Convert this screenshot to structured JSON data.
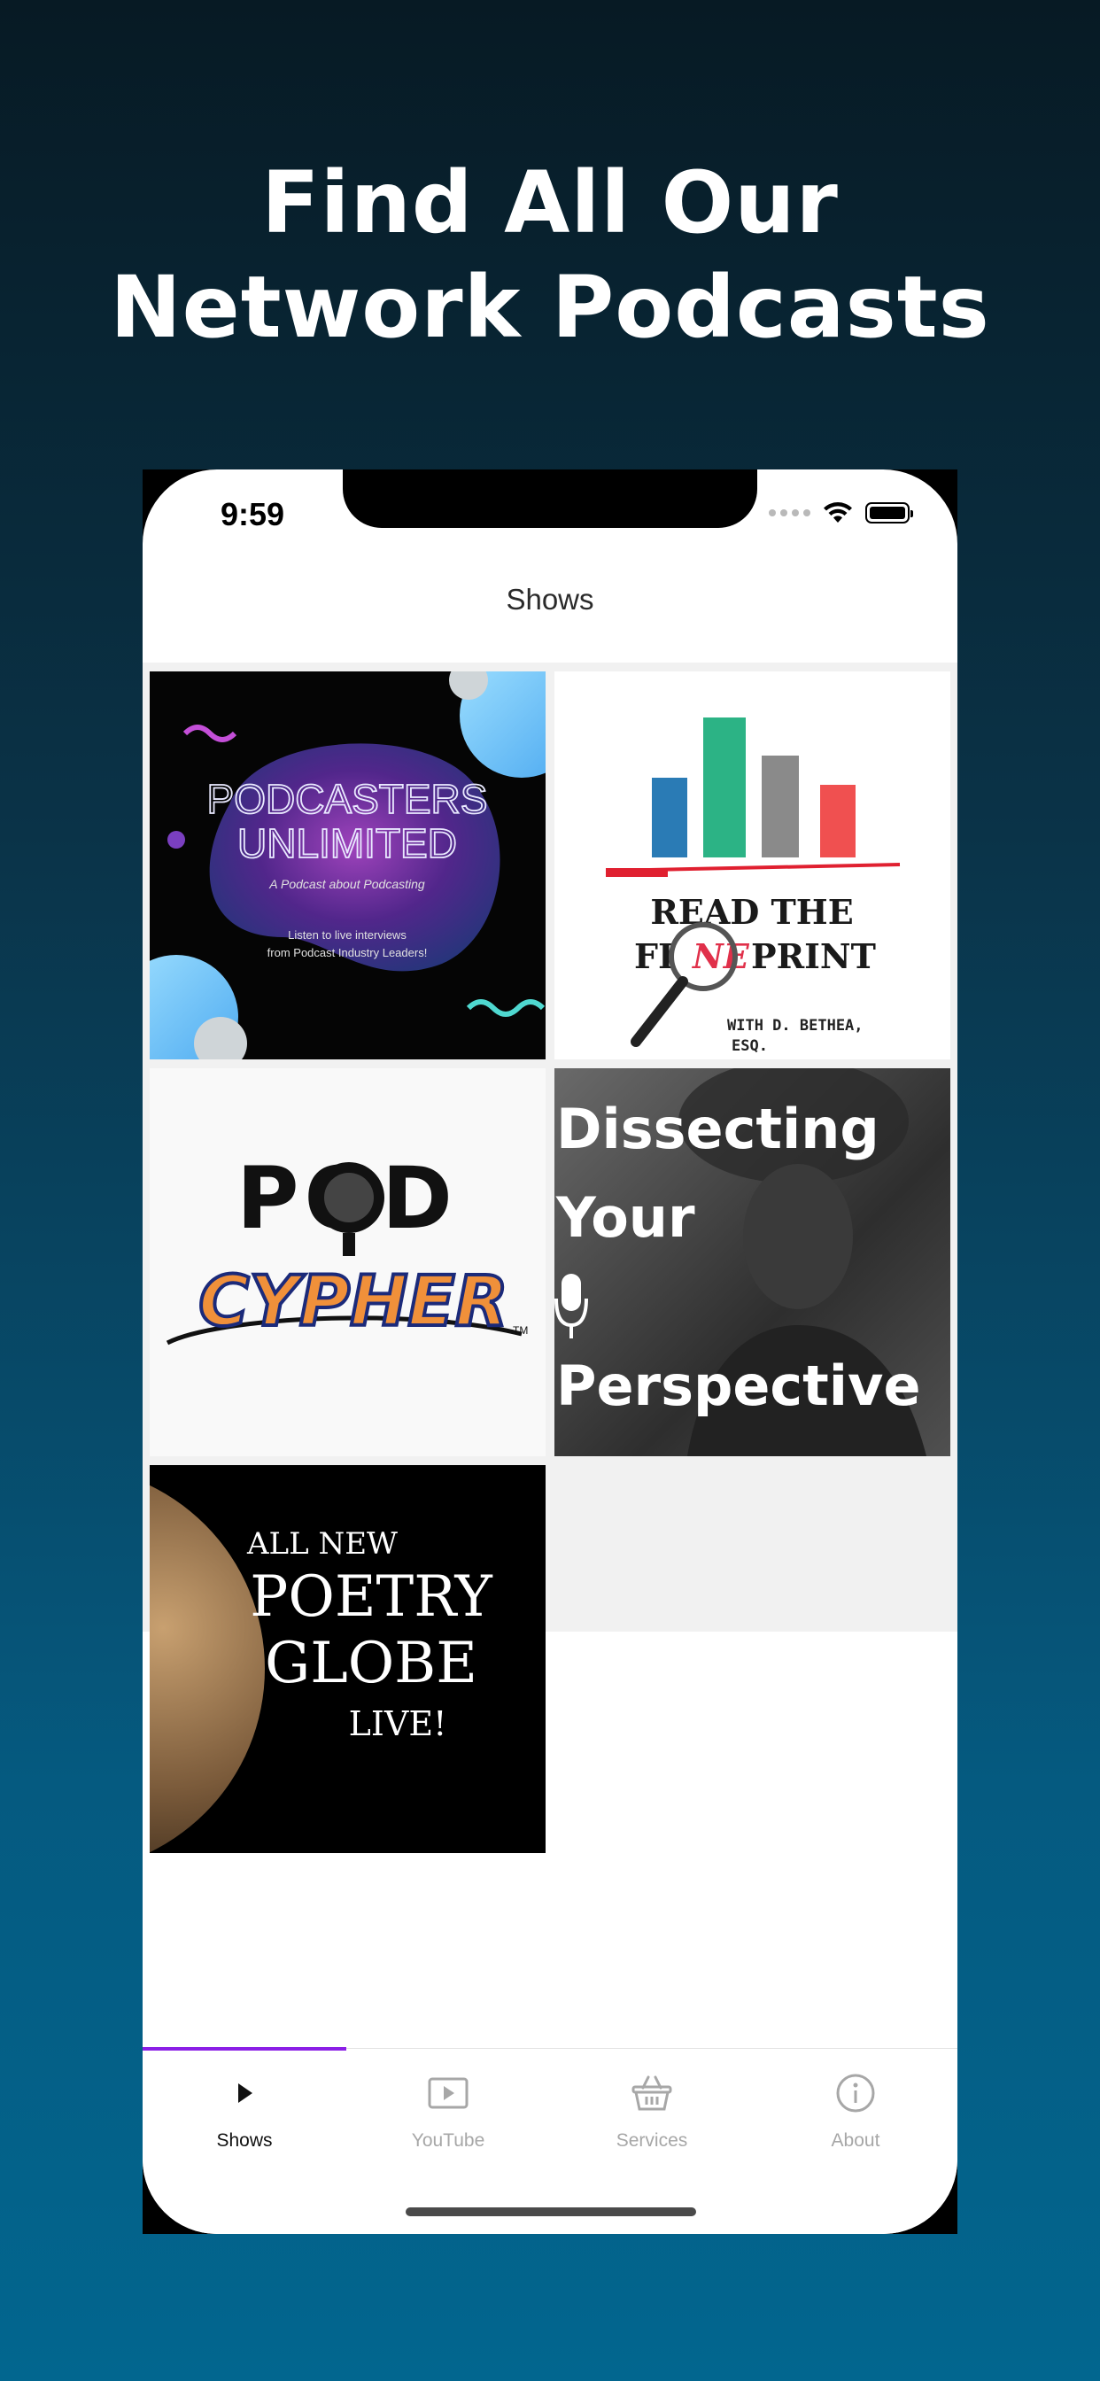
{
  "headline": {
    "line1": "Find All Our",
    "line2": "Network Podcasts"
  },
  "status_bar": {
    "time": "9:59"
  },
  "nav": {
    "title": "Shows"
  },
  "shows": [
    {
      "title_line1": "PODCASTERS",
      "title_line2": "UNLIMITED",
      "subtitle": "A Podcast about Podcasting",
      "desc_line1": "Listen to live interviews",
      "desc_line2": "from Podcast Industry Leaders!"
    },
    {
      "title_line1": "READ THE",
      "title_fi": "FI",
      "title_ne": "NE",
      "title_print": "PRINT",
      "byline": "WITH D. BETHEA,",
      "byline2": "ESQ."
    },
    {
      "title_line1": "POD",
      "title_line2": "CYPHER",
      "tm": "TM"
    },
    {
      "line1": "Dissecting",
      "line2": "Your",
      "line3": "Perspective"
    },
    {
      "line1": "ALL NEW",
      "line2": "POETRY",
      "line3": "GLOBE",
      "line4": "LIVE!"
    }
  ],
  "tabs": [
    {
      "label": "Shows",
      "icon": "play-icon",
      "active": true
    },
    {
      "label": "YouTube",
      "icon": "video-play-icon",
      "active": false
    },
    {
      "label": "Services",
      "icon": "basket-icon",
      "active": false
    },
    {
      "label": "About",
      "icon": "info-icon",
      "active": false
    }
  ],
  "colors": {
    "background_top": "#071a24",
    "background_bottom": "#02668f",
    "tab_accent": "#8b1fe6",
    "tab_inactive": "#a7a7a7"
  }
}
